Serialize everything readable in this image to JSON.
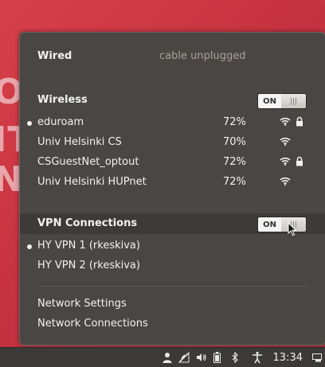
{
  "wired": {
    "title": "Wired",
    "status": "cable unplugged"
  },
  "wireless": {
    "title": "Wireless",
    "toggle": "ON",
    "networks": [
      {
        "name": "eduroam",
        "signal": "72%",
        "active": true,
        "secured": true
      },
      {
        "name": "Univ Helsinki CS",
        "signal": "70%",
        "active": false,
        "secured": false
      },
      {
        "name": "CSGuestNet_optout",
        "signal": "72%",
        "active": false,
        "secured": true
      },
      {
        "name": "Univ Helsinki HUPnet",
        "signal": "72%",
        "active": false,
        "secured": false
      }
    ]
  },
  "vpn": {
    "title": "VPN Connections",
    "toggle": "ON",
    "connections": [
      {
        "name": "HY VPN 1 (rkeskiva)",
        "active": true
      },
      {
        "name": "HY VPN 2 (rkeskiva)",
        "active": false
      }
    ]
  },
  "links": {
    "settings": "Network Settings",
    "connections": "Network Connections"
  },
  "panel": {
    "clock": "13:34"
  },
  "icons": [
    "wifi-icon",
    "lock-icon",
    "user-icon",
    "network-icon",
    "volume-icon",
    "battery-icon",
    "bluetooth-icon",
    "accessibility-icon",
    "window-icon",
    "cursor-icon"
  ],
  "colors": {
    "popup_bg": "#4a4643",
    "desktop_bg": "#c9333d",
    "panel_bg": "#3b3a38"
  }
}
